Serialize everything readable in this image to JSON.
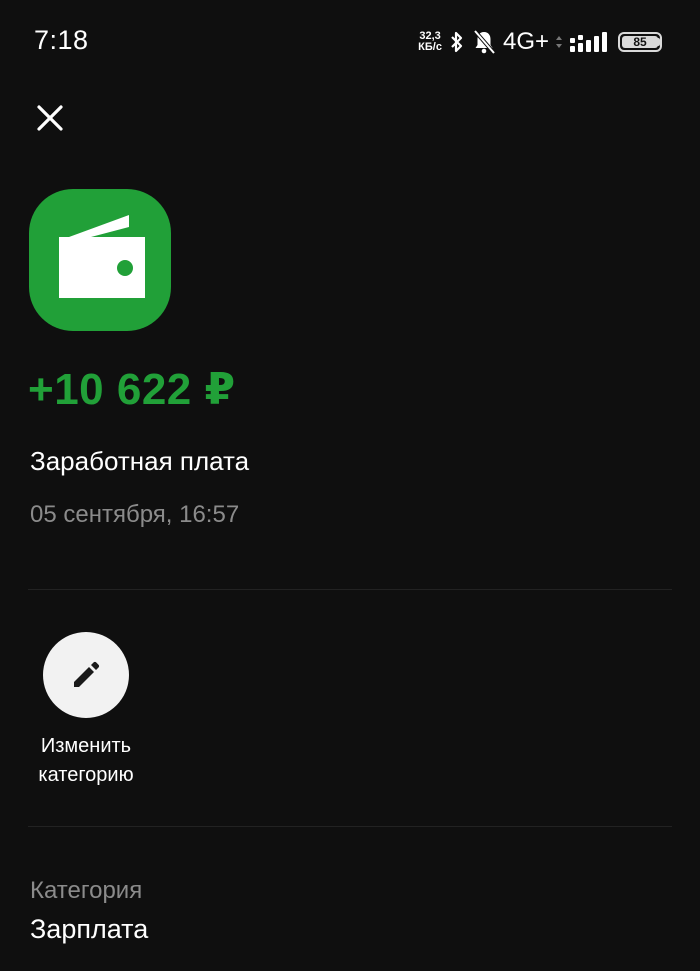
{
  "status_bar": {
    "time": "7:18",
    "net_speed_value": "32,3",
    "net_speed_unit": "КБ/с",
    "network_type": "4G+",
    "battery_level": "85"
  },
  "transaction": {
    "amount": "+10 622 ₽",
    "title": "Заработная плата",
    "date": "05 сентября, 16:57"
  },
  "actions": {
    "edit_category_line1": "Изменить",
    "edit_category_line2": "категорию"
  },
  "details": {
    "category_label": "Категория",
    "category_value": "Зарплата"
  },
  "colors": {
    "accent": "#21a038",
    "background": "#0f0f0f",
    "muted_text": "#8b8b8b"
  },
  "icons": [
    "close-icon",
    "wallet-icon",
    "pencil-icon",
    "bluetooth-icon",
    "bell-muted-icon",
    "signal-icon",
    "battery-icon"
  ]
}
